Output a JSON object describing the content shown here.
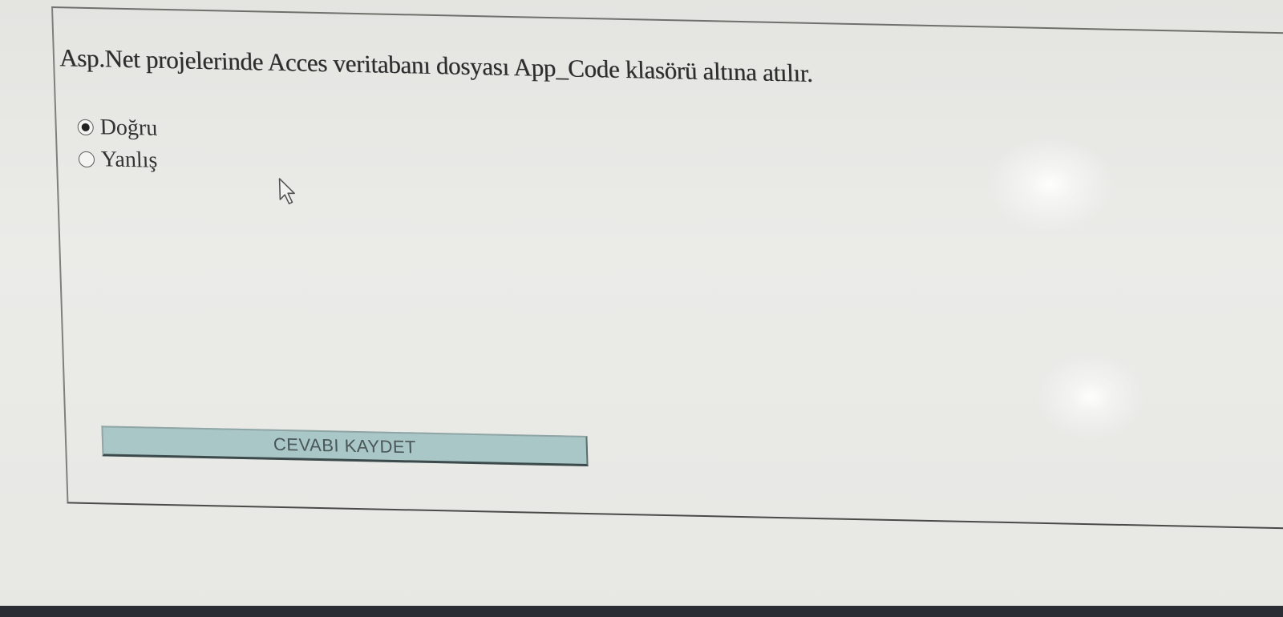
{
  "question": {
    "text": "Asp.Net projelerinde Acces veritabanı dosyası App_Code klasörü altına atılır."
  },
  "options": [
    {
      "label": "Doğru",
      "selected": true
    },
    {
      "label": "Yanlış",
      "selected": false
    }
  ],
  "actions": {
    "save_label": "CEVABI KAYDET"
  },
  "colors": {
    "button_bg": "#a9c7c6",
    "page_bg": "#e9e9e6"
  }
}
